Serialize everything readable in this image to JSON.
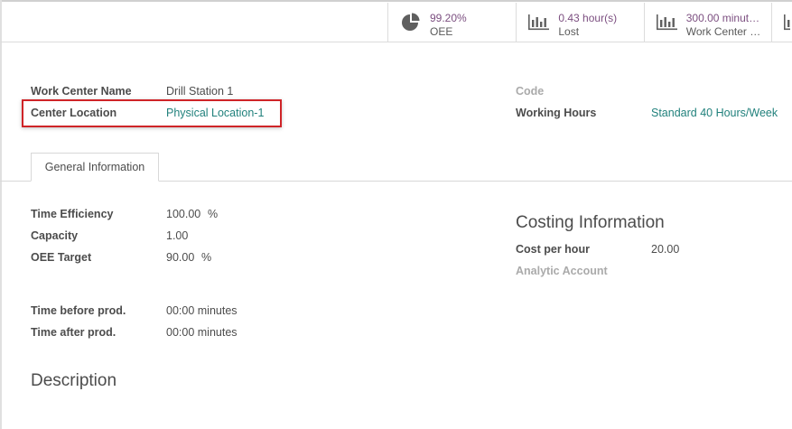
{
  "stat_buttons": [
    {
      "value": "99.20%",
      "label": "OEE",
      "icon": "pie-chart-icon"
    },
    {
      "value": "0.43 hour(s)",
      "label": "Lost",
      "icon": "bar-chart-icon"
    },
    {
      "value": "300.00 minut…",
      "label": "Work Center …",
      "icon": "bar-chart-icon"
    }
  ],
  "header": {
    "name_label": "Work Center Name",
    "name_value": "Drill Station 1",
    "location_label": "Center Location",
    "location_value": "Physical Location-1",
    "code_label": "Code",
    "hours_label": "Working Hours",
    "hours_value": "Standard 40 Hours/Week"
  },
  "tabs": [
    {
      "label": "General Information"
    }
  ],
  "general": {
    "efficiency_label": "Time Efficiency",
    "efficiency_value": "100.00",
    "efficiency_unit": "%",
    "capacity_label": "Capacity",
    "capacity_value": "1.00",
    "oee_label": "OEE Target",
    "oee_value": "90.00",
    "oee_unit": "%",
    "before_label": "Time before prod.",
    "before_value": "00:00 minutes",
    "after_label": "Time after prod.",
    "after_value": "00:00 minutes"
  },
  "costing": {
    "title": "Costing Information",
    "cost_label": "Cost per hour",
    "cost_value": "20.00",
    "analytic_label": "Analytic Account"
  },
  "description": {
    "title": "Description"
  },
  "colors": {
    "accent": "#7c4f80",
    "link": "#21817c",
    "highlight": "#cf2428"
  }
}
